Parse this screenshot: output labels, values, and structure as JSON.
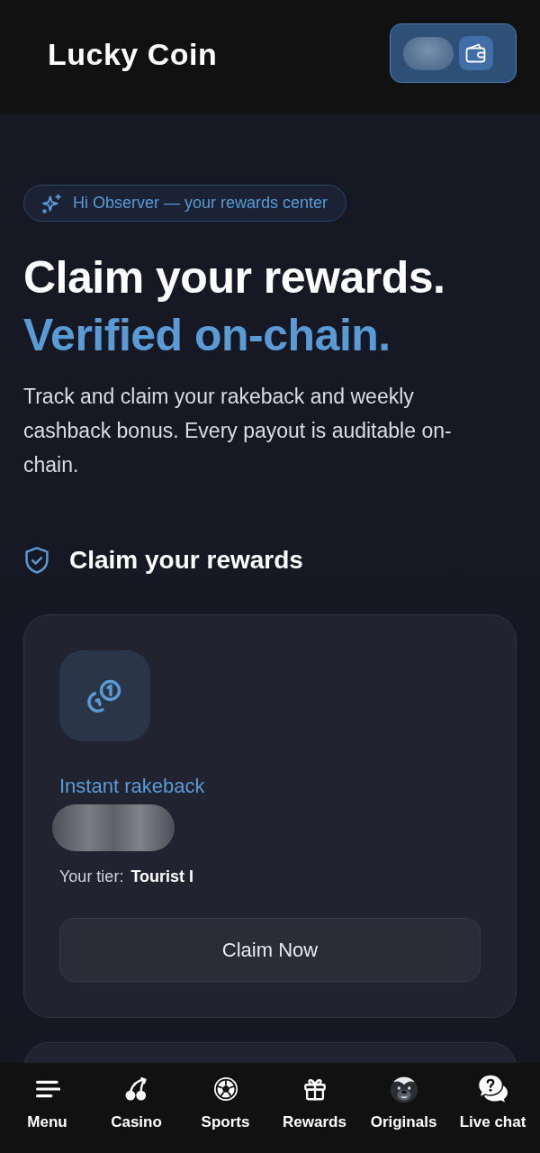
{
  "header": {
    "logo": "Lucky Coin"
  },
  "hero": {
    "badge": "Hi Observer — your rewards center",
    "title": "Claim your rewards.",
    "title_accent": "Verified on-chain.",
    "description": "Track and claim your rakeback and weekly cashback bonus. Every payout is auditable on-chain."
  },
  "section": {
    "title": "Claim your rewards"
  },
  "reward_cards": [
    {
      "title": "Instant rakeback",
      "tier_label": "Your tier:",
      "tier_value": "Tourist I",
      "button": "Claim Now"
    }
  ],
  "bottom_nav": [
    {
      "kind": "menu",
      "label": "Menu"
    },
    {
      "kind": "casino",
      "label": "Casino"
    },
    {
      "kind": "sports",
      "label": "Sports"
    },
    {
      "kind": "rewards",
      "label": "Rewards"
    },
    {
      "kind": "originals",
      "label": "Originals"
    },
    {
      "kind": "chat",
      "label": "Live chat"
    }
  ]
}
